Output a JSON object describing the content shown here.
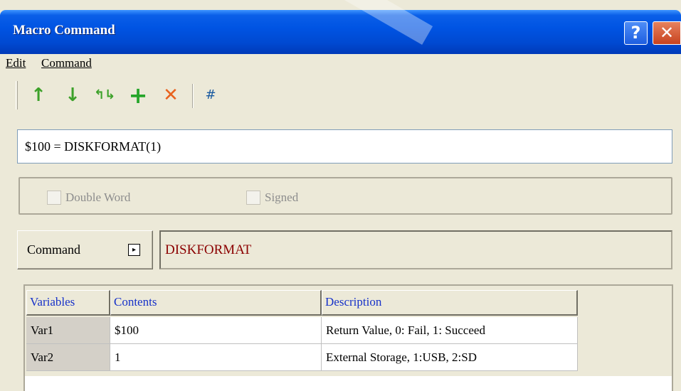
{
  "window": {
    "title": "Macro Command"
  },
  "titlebar": {
    "help_label": "?",
    "close_label": "✕"
  },
  "menu": {
    "edit": "Edit",
    "command": "Command"
  },
  "toolbar": {
    "up_icon": "↑",
    "down_icon": "↓",
    "swap_icon": "↰↳",
    "add_icon": "+",
    "delete_icon": "✕",
    "hash_icon": "#"
  },
  "expression": {
    "value": "$100 = DISKFORMAT(1)"
  },
  "options": {
    "double_word": "Double Word",
    "signed": "Signed"
  },
  "command": {
    "button_label": "Command",
    "arrow": "▸",
    "name": "DISKFORMAT"
  },
  "grid": {
    "headers": [
      "Variables",
      "Contents",
      "Description"
    ],
    "rows": [
      {
        "variable": "Var1",
        "contents": "$100",
        "description": "Return Value, 0: Fail, 1: Succeed"
      },
      {
        "variable": "Var2",
        "contents": "1",
        "description": "External Storage, 1:USB, 2:SD"
      }
    ]
  },
  "colors": {
    "title_bar": "#0054e3",
    "header_text": "#1631c9",
    "command_name": "#8b0000"
  }
}
